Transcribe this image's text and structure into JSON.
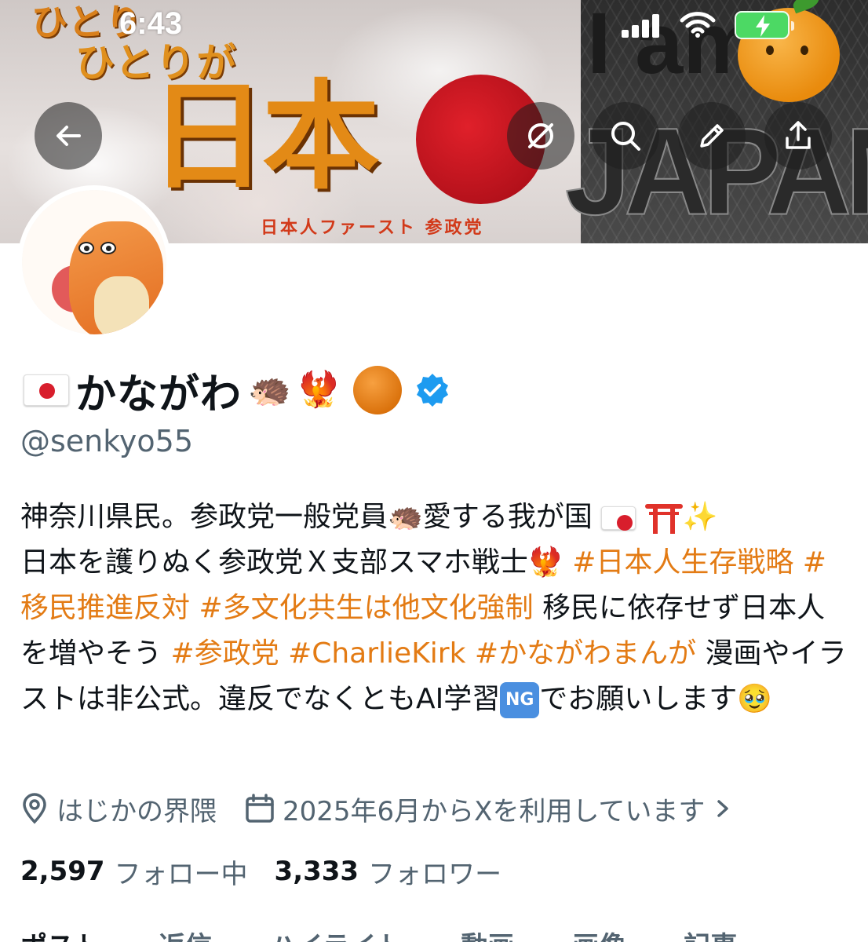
{
  "status_bar": {
    "time": "6:43"
  },
  "banner": {
    "line1": "ひとり",
    "line2": "ひとりが",
    "big_text": "日本",
    "sub_text": "日本人ファースト 参政党",
    "right_line1": "I am",
    "right_line2": "JAPAN"
  },
  "icons": {
    "back": "arrow-left-icon",
    "grok": "slash-circle-icon",
    "search": "search-icon",
    "edit": "pencil-icon",
    "share": "share-icon",
    "location": "location-pin-icon",
    "calendar": "calendar-icon",
    "verified": "verified-badge-icon"
  },
  "profile": {
    "display_name": "かながわ",
    "name_emojis": [
      "🦔",
      "🐦‍🔥"
    ],
    "handle": "@senkyo55",
    "bio": {
      "t1": "神奈川県民。参政党一般党員",
      "e1": "🦔",
      "t2": "愛する我が国 ",
      "e2": "✨",
      "t3": "日本を護りぬく参政党Ｘ支部スマホ戦士",
      "e3": "🐦‍🔥",
      "tag1": " #日本人生存戦略",
      "tag2": " #移民推進反対",
      "tag3": " #多文化共生は他文化強制",
      "t4": " 移民に依存せず日本人を増やそう",
      "tag4": " #参政党",
      "tag5": " #CharlieKirk",
      "tag6": " #かながわまんが",
      "t5": " 漫画やイラストは非公式。違反でなくともAI学習",
      "ng": "NG",
      "t6": "でお願いします",
      "e4": "🥹"
    },
    "location": "はじかの界隈",
    "joined": "2025年6月からXを利用しています",
    "following_count": "2,597",
    "following_label": "フォロー中",
    "followers_count": "3,333",
    "followers_label": "フォロワー"
  },
  "tabs": [
    "ポスト",
    "返信",
    "ハイライト",
    "動画",
    "画像",
    "記事"
  ],
  "colors": {
    "accent": "#e37b14",
    "muted": "#536471",
    "verified": "#1d9bf0"
  }
}
